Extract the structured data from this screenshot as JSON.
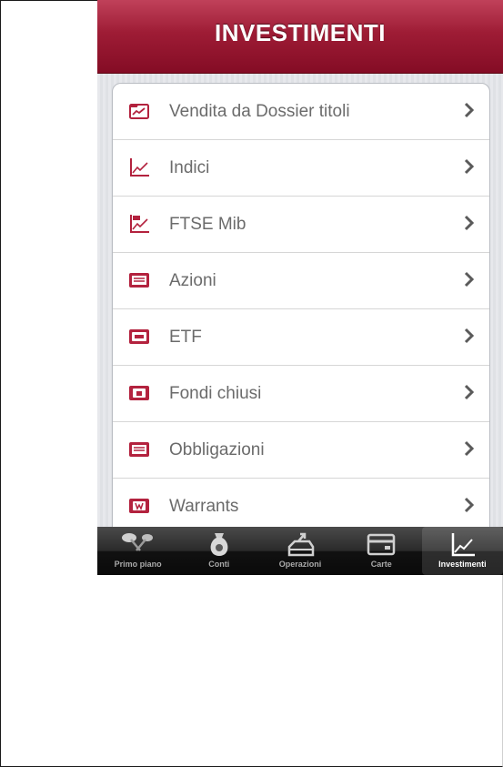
{
  "header": {
    "title": "INVESTIMENTI"
  },
  "menu": {
    "items": [
      {
        "label": "Vendita da Dossier titoli",
        "icon": "folder-chart-icon"
      },
      {
        "label": "Indici",
        "icon": "line-chart-icon"
      },
      {
        "label": "FTSE Mib",
        "icon": "mib-chart-icon"
      },
      {
        "label": "Azioni",
        "icon": "stock-certificate-icon"
      },
      {
        "label": "ETF",
        "icon": "etf-card-icon"
      },
      {
        "label": "Fondi chiusi",
        "icon": "lock-card-icon"
      },
      {
        "label": "Obbligazioni",
        "icon": "bond-certificate-icon"
      },
      {
        "label": "Warrants",
        "icon": "warrant-card-icon"
      }
    ]
  },
  "tabbar": {
    "tabs": [
      {
        "label": "Primo piano",
        "icon": "pushpins-icon",
        "active": false
      },
      {
        "label": "Conti",
        "icon": "money-bag-icon",
        "active": false
      },
      {
        "label": "Operazioni",
        "icon": "transfer-tray-icon",
        "active": false
      },
      {
        "label": "Carte",
        "icon": "card-icon",
        "active": false
      },
      {
        "label": "Investimenti",
        "icon": "chart-icon",
        "active": true
      }
    ]
  },
  "colors": {
    "brand": "#9e1c35",
    "icon": "#b3223e"
  }
}
